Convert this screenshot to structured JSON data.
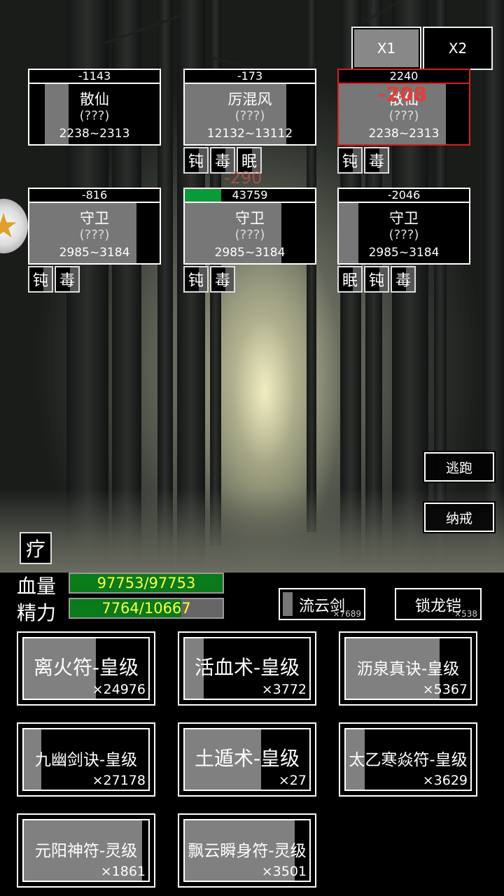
{
  "speed_buttons": [
    {
      "label": "X1"
    },
    {
      "label": "X2"
    }
  ],
  "enemies": [
    {
      "hp": "-1143",
      "name": "散仙",
      "q": "(???)",
      "range": "2238~2313",
      "gray_fraction": 0.18,
      "hp_fill": 0,
      "tags": []
    },
    {
      "hp": "-173",
      "name": "厉混风",
      "q": "(???)",
      "range": "12132~13112",
      "gray_fraction": 0.78,
      "hp_fill": 0,
      "tags": [
        "钝",
        "毒",
        "眠"
      ]
    },
    {
      "hp": "2240",
      "name": "散仙",
      "q": "(???)",
      "range": "2238~2313",
      "gray_fraction": 0.82,
      "hp_fill": 0,
      "tags": [
        "钝",
        "毒"
      ],
      "float": "-208"
    },
    {
      "hp": "-816",
      "name": "守卫",
      "q": "(???)",
      "range": "2985~3184",
      "gray_fraction": 0.82,
      "hp_fill": 0,
      "tags": [
        "钝",
        "毒"
      ]
    },
    {
      "hp": "43759",
      "name": "守卫",
      "q": "(???)",
      "range": "2985~3184",
      "gray_fraction": 0.74,
      "hp_fill": 0.28,
      "tags": [
        "钝",
        "毒"
      ],
      "float": "-290"
    },
    {
      "hp": "-2046",
      "name": "守卫",
      "q": "(???)",
      "range": "2985~3184",
      "gray_fraction": 0.15,
      "hp_fill": 0,
      "tags": [
        "眠",
        "钝",
        "毒"
      ]
    }
  ],
  "side": {
    "flee": "逃跑",
    "ring": "纳戒",
    "heal": "疗"
  },
  "player": {
    "hp_label": "血量",
    "hp_value": "97753/97753",
    "hp_fraction": 1.0,
    "mp_label": "精力",
    "mp_value": "7764/10667",
    "mp_fraction": 0.728
  },
  "weapons": [
    {
      "name": "流云剑",
      "count": "×7689"
    },
    {
      "name": "锁龙铠",
      "count": "×538"
    }
  ],
  "skills": [
    {
      "name": "离火符-皇级",
      "count": "×24976",
      "gray_fraction": 0.58
    },
    {
      "name": "活血术-皇级",
      "count": "×3772",
      "gray_fraction": 0.15
    },
    {
      "name": "沥泉真诀-皇级",
      "count": "×5367",
      "gray_fraction": 0.75
    },
    {
      "name": "九幽剑诀-皇级",
      "count": "×27178",
      "gray_fraction": 0.14
    },
    {
      "name": "土遁术-皇级",
      "count": "×27",
      "gray_fraction": 0.61
    },
    {
      "name": "太乙寒焱符-皇级",
      "count": "×3629",
      "gray_fraction": 0.15
    },
    {
      "name": "元阳神符-灵级",
      "count": "×1861",
      "gray_fraction": 0.95
    },
    {
      "name": "飘云瞬身符-灵级",
      "count": "×3501",
      "gray_fraction": 0.88
    }
  ]
}
